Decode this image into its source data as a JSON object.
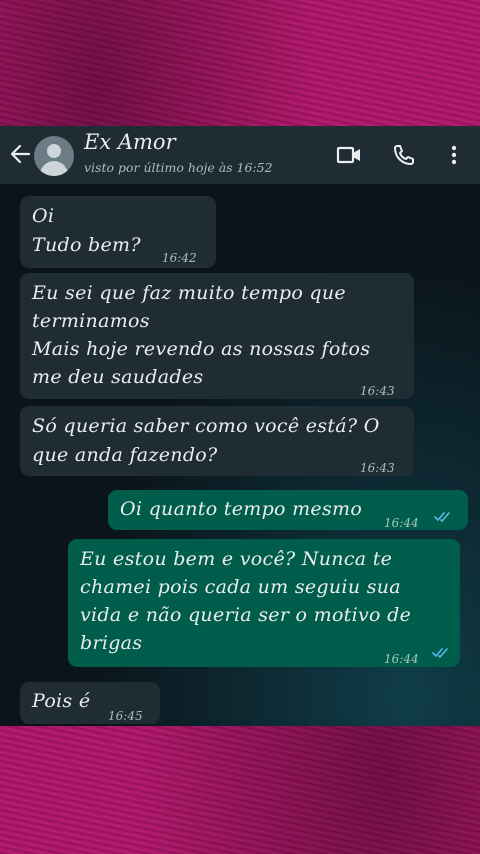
{
  "header": {
    "contact_name": "Ex Amor",
    "last_seen": "visto por último hoje às 16:52"
  },
  "icons": [
    "back-arrow-icon",
    "avatar-icon",
    "video-call-icon",
    "phone-call-icon",
    "more-options-icon",
    "double-check-icon"
  ],
  "colors": {
    "background": "#b0166a",
    "chat_bg": "#0b141a",
    "header_bg": "#1f2c34",
    "incoming_bubble": "#202c33",
    "outgoing_bubble": "#005c4b",
    "read_ticks": "#53bdeb"
  },
  "messages": [
    {
      "direction": "in",
      "text": "Oi\nTudo bem?",
      "time": "16:42"
    },
    {
      "direction": "in",
      "text": "Eu sei que faz muito tempo que\nterminamos\nMais hoje revendo as nossas fotos\nme deu saudades",
      "time": "16:43"
    },
    {
      "direction": "in",
      "text": "Só queria saber como você está? O\nque anda fazendo?",
      "time": "16:43"
    },
    {
      "direction": "out",
      "text": "Oi quanto tempo mesmo",
      "time": "16:44",
      "status": "read"
    },
    {
      "direction": "out",
      "text": "Eu estou bem e você? Nunca te\nchamei pois cada um seguiu sua\nvida e não queria ser o motivo de\nbrigas",
      "time": "16:44",
      "status": "read"
    },
    {
      "direction": "in",
      "text": "Pois é",
      "time": "16:45"
    }
  ]
}
